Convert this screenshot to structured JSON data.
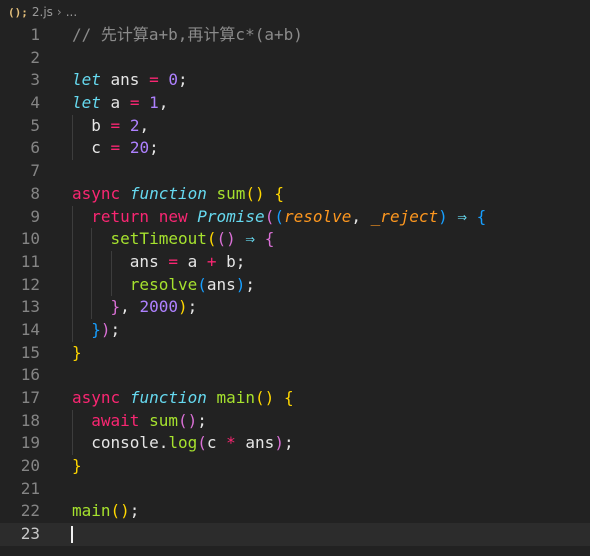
{
  "breadcrumb": {
    "file_icon": "(); ",
    "file_name": "2.js",
    "separator": "›",
    "ellipsis": "..."
  },
  "editor": {
    "current_line": 23,
    "lines": [
      {
        "n": "1",
        "tokens": [
          {
            "t": "// 先计算a+b,再计算c*(a+b)",
            "c": "comment"
          }
        ]
      },
      {
        "n": "2",
        "tokens": []
      },
      {
        "n": "3",
        "tokens": [
          {
            "t": "let",
            "c": "italic"
          },
          {
            "t": " ans ",
            "c": "plain"
          },
          {
            "t": "=",
            "c": "op"
          },
          {
            "t": " ",
            "c": "plain"
          },
          {
            "t": "0",
            "c": "num"
          },
          {
            "t": ";",
            "c": "plain"
          }
        ]
      },
      {
        "n": "4",
        "tokens": [
          {
            "t": "let",
            "c": "italic"
          },
          {
            "t": " a ",
            "c": "plain"
          },
          {
            "t": "=",
            "c": "op"
          },
          {
            "t": " ",
            "c": "plain"
          },
          {
            "t": "1",
            "c": "num"
          },
          {
            "t": ",",
            "c": "plain"
          }
        ]
      },
      {
        "n": "5",
        "tokens": [
          {
            "t": "  b ",
            "c": "plain"
          },
          {
            "t": "=",
            "c": "op"
          },
          {
            "t": " ",
            "c": "plain"
          },
          {
            "t": "2",
            "c": "num"
          },
          {
            "t": ",",
            "c": "plain"
          }
        ]
      },
      {
        "n": "6",
        "tokens": [
          {
            "t": "  c ",
            "c": "plain"
          },
          {
            "t": "=",
            "c": "op"
          },
          {
            "t": " ",
            "c": "plain"
          },
          {
            "t": "20",
            "c": "num"
          },
          {
            "t": ";",
            "c": "plain"
          }
        ]
      },
      {
        "n": "7",
        "tokens": []
      },
      {
        "n": "8",
        "tokens": [
          {
            "t": "async",
            "c": "kw"
          },
          {
            "t": " ",
            "c": "plain"
          },
          {
            "t": "function",
            "c": "italic"
          },
          {
            "t": " ",
            "c": "plain"
          },
          {
            "t": "sum",
            "c": "fn"
          },
          {
            "t": "()",
            "c": "b1"
          },
          {
            "t": " ",
            "c": "plain"
          },
          {
            "t": "{",
            "c": "b1"
          }
        ]
      },
      {
        "n": "9",
        "tokens": [
          {
            "t": "  ",
            "c": "plain"
          },
          {
            "t": "return",
            "c": "kw"
          },
          {
            "t": " ",
            "c": "plain"
          },
          {
            "t": "new",
            "c": "kw"
          },
          {
            "t": " ",
            "c": "plain"
          },
          {
            "t": "Promise",
            "c": "italic"
          },
          {
            "t": "(",
            "c": "b2"
          },
          {
            "t": "(",
            "c": "b3"
          },
          {
            "t": "resolve",
            "c": "param"
          },
          {
            "t": ", ",
            "c": "plain"
          },
          {
            "t": "_reject",
            "c": "param"
          },
          {
            "t": ")",
            "c": "b3"
          },
          {
            "t": " ",
            "c": "plain"
          },
          {
            "t": "⇒",
            "c": "arrow"
          },
          {
            "t": " ",
            "c": "plain"
          },
          {
            "t": "{",
            "c": "b3"
          }
        ]
      },
      {
        "n": "10",
        "tokens": [
          {
            "t": "    ",
            "c": "plain"
          },
          {
            "t": "setTimeout",
            "c": "fn"
          },
          {
            "t": "(",
            "c": "b1"
          },
          {
            "t": "()",
            "c": "b2"
          },
          {
            "t": " ",
            "c": "plain"
          },
          {
            "t": "⇒",
            "c": "arrow"
          },
          {
            "t": " ",
            "c": "plain"
          },
          {
            "t": "{",
            "c": "b2"
          }
        ]
      },
      {
        "n": "11",
        "tokens": [
          {
            "t": "      ans ",
            "c": "plain"
          },
          {
            "t": "=",
            "c": "op"
          },
          {
            "t": " a ",
            "c": "plain"
          },
          {
            "t": "+",
            "c": "op"
          },
          {
            "t": " b;",
            "c": "plain"
          }
        ]
      },
      {
        "n": "12",
        "tokens": [
          {
            "t": "      ",
            "c": "plain"
          },
          {
            "t": "resolve",
            "c": "fn"
          },
          {
            "t": "(",
            "c": "b3"
          },
          {
            "t": "ans",
            "c": "plain"
          },
          {
            "t": ")",
            "c": "b3"
          },
          {
            "t": ";",
            "c": "plain"
          }
        ]
      },
      {
        "n": "13",
        "tokens": [
          {
            "t": "    ",
            "c": "plain"
          },
          {
            "t": "}",
            "c": "b2"
          },
          {
            "t": ", ",
            "c": "plain"
          },
          {
            "t": "2000",
            "c": "num"
          },
          {
            "t": ")",
            "c": "b1"
          },
          {
            "t": ";",
            "c": "plain"
          }
        ]
      },
      {
        "n": "14",
        "tokens": [
          {
            "t": "  ",
            "c": "plain"
          },
          {
            "t": "}",
            "c": "b3"
          },
          {
            "t": ")",
            "c": "b2"
          },
          {
            "t": ";",
            "c": "plain"
          }
        ]
      },
      {
        "n": "15",
        "tokens": [
          {
            "t": "}",
            "c": "b1"
          }
        ]
      },
      {
        "n": "16",
        "tokens": []
      },
      {
        "n": "17",
        "tokens": [
          {
            "t": "async",
            "c": "kw"
          },
          {
            "t": " ",
            "c": "plain"
          },
          {
            "t": "function",
            "c": "italic"
          },
          {
            "t": " ",
            "c": "plain"
          },
          {
            "t": "main",
            "c": "fn"
          },
          {
            "t": "()",
            "c": "b1"
          },
          {
            "t": " ",
            "c": "plain"
          },
          {
            "t": "{",
            "c": "b1"
          }
        ]
      },
      {
        "n": "18",
        "tokens": [
          {
            "t": "  ",
            "c": "plain"
          },
          {
            "t": "await",
            "c": "kw"
          },
          {
            "t": " ",
            "c": "plain"
          },
          {
            "t": "sum",
            "c": "fn"
          },
          {
            "t": "()",
            "c": "b2"
          },
          {
            "t": ";",
            "c": "plain"
          }
        ]
      },
      {
        "n": "19",
        "tokens": [
          {
            "t": "  console.",
            "c": "plain"
          },
          {
            "t": "log",
            "c": "fn"
          },
          {
            "t": "(",
            "c": "b2"
          },
          {
            "t": "c ",
            "c": "plain"
          },
          {
            "t": "*",
            "c": "op"
          },
          {
            "t": " ans",
            "c": "plain"
          },
          {
            "t": ")",
            "c": "b2"
          },
          {
            "t": ";",
            "c": "plain"
          }
        ]
      },
      {
        "n": "20",
        "tokens": [
          {
            "t": "}",
            "c": "b1"
          }
        ]
      },
      {
        "n": "21",
        "tokens": []
      },
      {
        "n": "22",
        "tokens": [
          {
            "t": "main",
            "c": "fn"
          },
          {
            "t": "()",
            "c": "b1"
          },
          {
            "t": ";",
            "c": "plain"
          }
        ]
      },
      {
        "n": "23",
        "tokens": []
      }
    ],
    "guides": [
      {
        "line": 5,
        "col": 0
      },
      {
        "line": 6,
        "col": 0
      },
      {
        "line": 9,
        "col": 0
      },
      {
        "line": 10,
        "col": 0
      },
      {
        "line": 11,
        "col": 0
      },
      {
        "line": 12,
        "col": 0
      },
      {
        "line": 13,
        "col": 0
      },
      {
        "line": 14,
        "col": 0
      },
      {
        "line": 10,
        "col": 1
      },
      {
        "line": 11,
        "col": 1
      },
      {
        "line": 12,
        "col": 1
      },
      {
        "line": 13,
        "col": 1
      },
      {
        "line": 11,
        "col": 2
      },
      {
        "line": 12,
        "col": 2
      },
      {
        "line": 18,
        "col": 0
      },
      {
        "line": 19,
        "col": 0
      }
    ]
  }
}
